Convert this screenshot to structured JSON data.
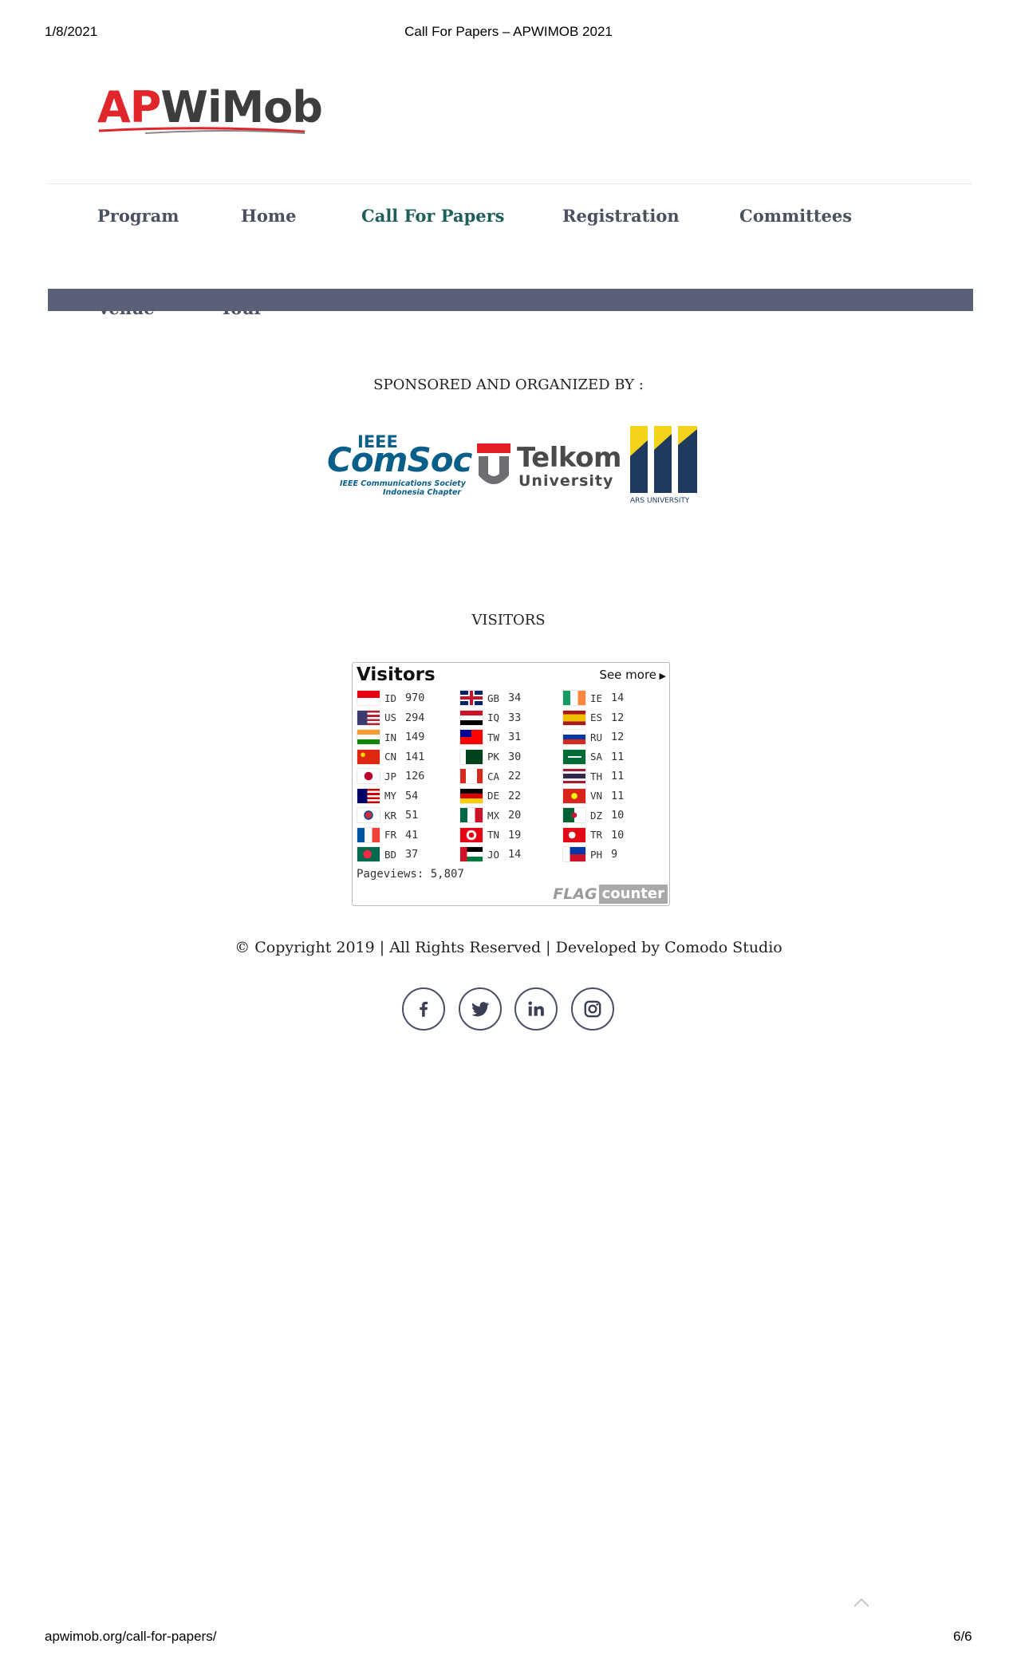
{
  "print_header": {
    "date": "1/8/2021",
    "title": "Call For Papers – APWIMOB 2021"
  },
  "print_footer": {
    "url": "apwimob.org/call-for-papers/",
    "page": "6/6"
  },
  "logo": {
    "part1": "AP",
    "part2": "WiMob"
  },
  "nav": {
    "items": [
      "Program",
      "Home",
      "Call For Papers",
      "Registration",
      "Committees"
    ],
    "items_row2": [
      "Venue",
      "Tour"
    ],
    "active": "Call For Papers"
  },
  "sponsors": {
    "heading": "SPONSORED AND ORGANIZED BY :",
    "logos": [
      {
        "name": "IEEE ComSoc",
        "lines": [
          "IEEE",
          "ComSoc",
          "IEEE Communications Society",
          "Indonesia Chapter"
        ]
      },
      {
        "name": "Telkom University",
        "lines": [
          "Telkom",
          "University"
        ]
      },
      {
        "name": "ARS University",
        "lines": [
          "ARS UNIVERSITY"
        ]
      }
    ]
  },
  "visitors": {
    "heading": "VISITORS",
    "widget_title": "Visitors",
    "see_more": "See more",
    "columns": [
      [
        {
          "cc": "ID",
          "n": "970"
        },
        {
          "cc": "US",
          "n": "294"
        },
        {
          "cc": "IN",
          "n": "149"
        },
        {
          "cc": "CN",
          "n": "141"
        },
        {
          "cc": "JP",
          "n": "126"
        },
        {
          "cc": "MY",
          "n": "54"
        },
        {
          "cc": "KR",
          "n": "51"
        },
        {
          "cc": "FR",
          "n": "41"
        },
        {
          "cc": "BD",
          "n": "37"
        }
      ],
      [
        {
          "cc": "GB",
          "n": "34"
        },
        {
          "cc": "IQ",
          "n": "33"
        },
        {
          "cc": "TW",
          "n": "31"
        },
        {
          "cc": "PK",
          "n": "30"
        },
        {
          "cc": "CA",
          "n": "22"
        },
        {
          "cc": "DE",
          "n": "22"
        },
        {
          "cc": "MX",
          "n": "20"
        },
        {
          "cc": "TN",
          "n": "19"
        },
        {
          "cc": "JO",
          "n": "14"
        }
      ],
      [
        {
          "cc": "IE",
          "n": "14"
        },
        {
          "cc": "ES",
          "n": "12"
        },
        {
          "cc": "RU",
          "n": "12"
        },
        {
          "cc": "SA",
          "n": "11"
        },
        {
          "cc": "TH",
          "n": "11"
        },
        {
          "cc": "VN",
          "n": "11"
        },
        {
          "cc": "DZ",
          "n": "10"
        },
        {
          "cc": "TR",
          "n": "10"
        },
        {
          "cc": "PH",
          "n": "9"
        }
      ]
    ],
    "pageviews": "Pageviews: 5,807",
    "brand_flag": "FLAG",
    "brand_counter": "counter"
  },
  "footer": {
    "copyright": "© Copyright 2019 | All Rights Reserved | Developed by Comodo Studio",
    "social": [
      "facebook-icon",
      "twitter-icon",
      "linkedin-icon",
      "instagram-icon"
    ]
  },
  "colors": {
    "accent": "#1f5f5a",
    "nav_text": "#4a5260",
    "nav_bar": "#5a6177",
    "logo_red": "#e0262b"
  }
}
